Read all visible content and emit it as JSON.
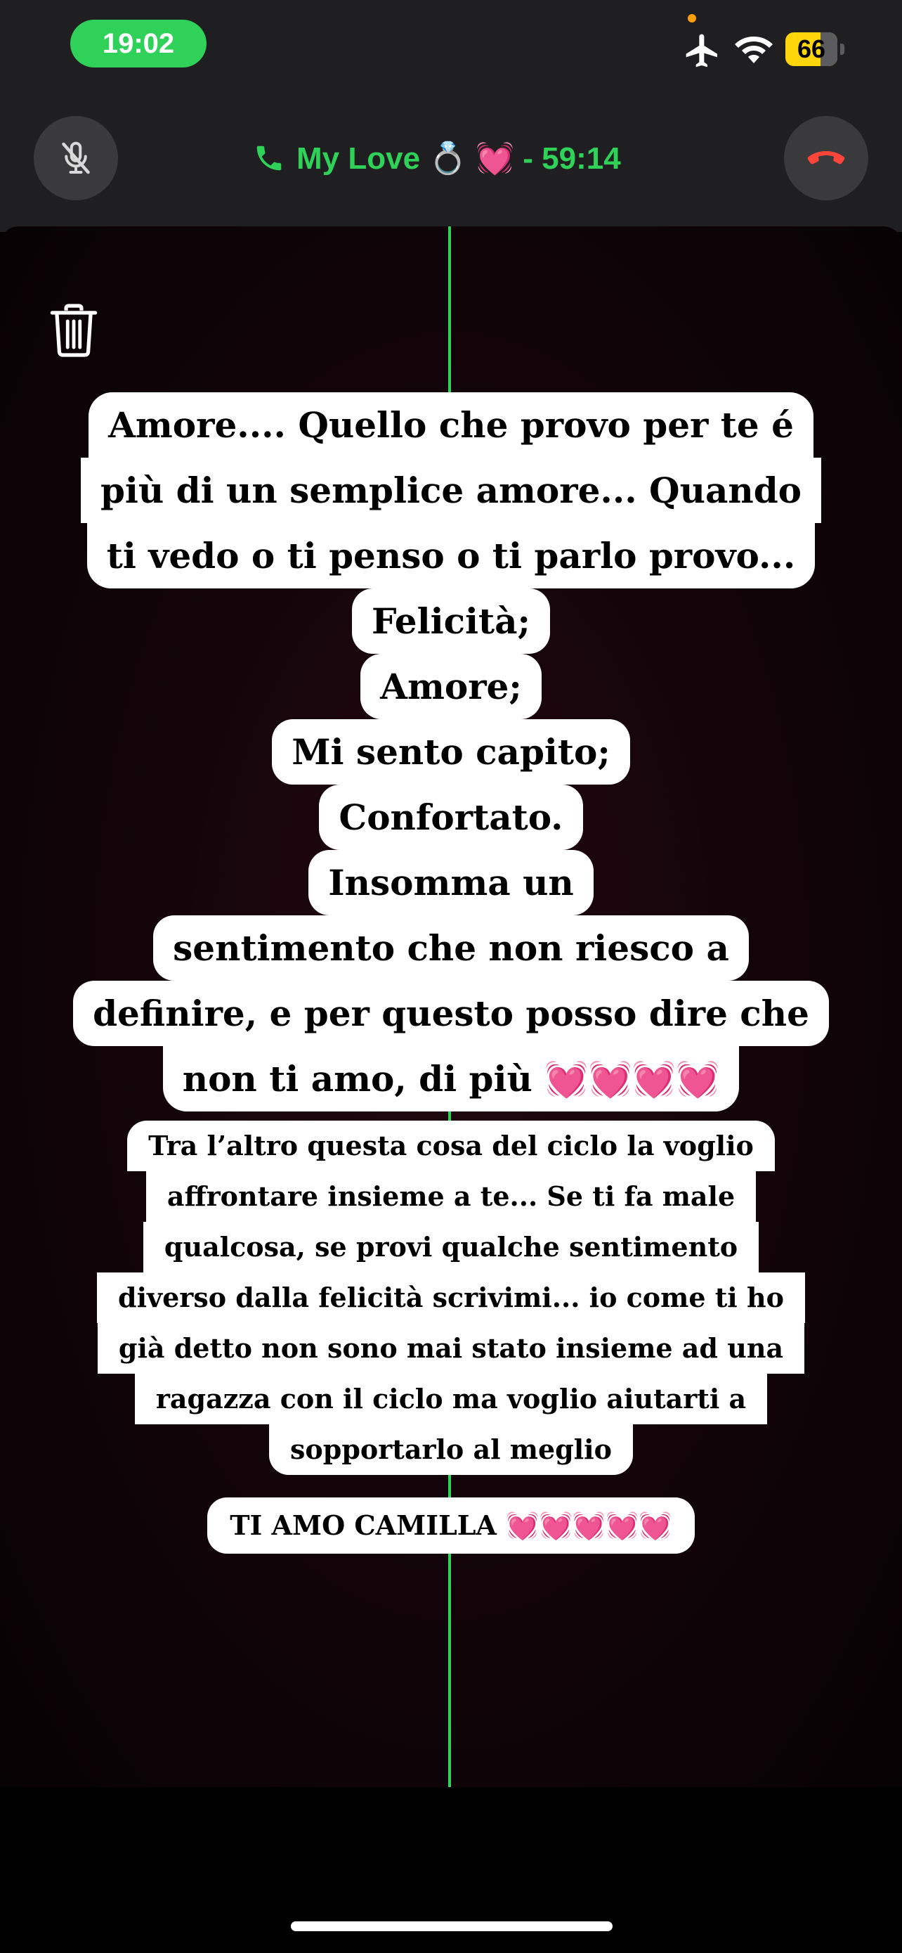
{
  "status_bar": {
    "time": "19:02",
    "battery": "66",
    "icons": [
      "airplane-icon",
      "wifi-icon",
      "battery-icon"
    ],
    "colors": {
      "time_pill": "#30d158",
      "battery": "#ffd60a",
      "privacy_dot": "#ff9f0a"
    }
  },
  "call_bar": {
    "label": "My Love 💍 💓 - 59:14",
    "mute_icon": "mic-slash-icon",
    "end_icon": "end-call-icon",
    "accent": "#30d158"
  },
  "story": {
    "trash_icon": "trash-icon",
    "block1": [
      "Amore....  Quello che provo per te é",
      "più  di un semplice amore... Quando",
      "ti vedo o ti penso o ti parlo provo...",
      "Felicità;",
      "Amore;",
      "Mi sento capito;",
      "Confortato.",
      "Insomma un",
      "sentimento che non riesco a",
      "definire, e per questo posso dire che",
      "non ti amo, di più 💓💓💓💓"
    ],
    "block2": [
      "Tra l’altro questa cosa del ciclo la voglio",
      "affrontare insieme a te... Se ti fa male",
      "qualcosa, se provi qualche sentimento",
      "diverso dalla felicità scrivimi... io come ti ho",
      "già detto non sono mai stato insieme ad una",
      "ragazza con il ciclo ma voglio aiutarti a",
      "sopportarlo al meglio"
    ],
    "block3": "TI AMO CAMILLA 💓💓💓💓💓"
  }
}
